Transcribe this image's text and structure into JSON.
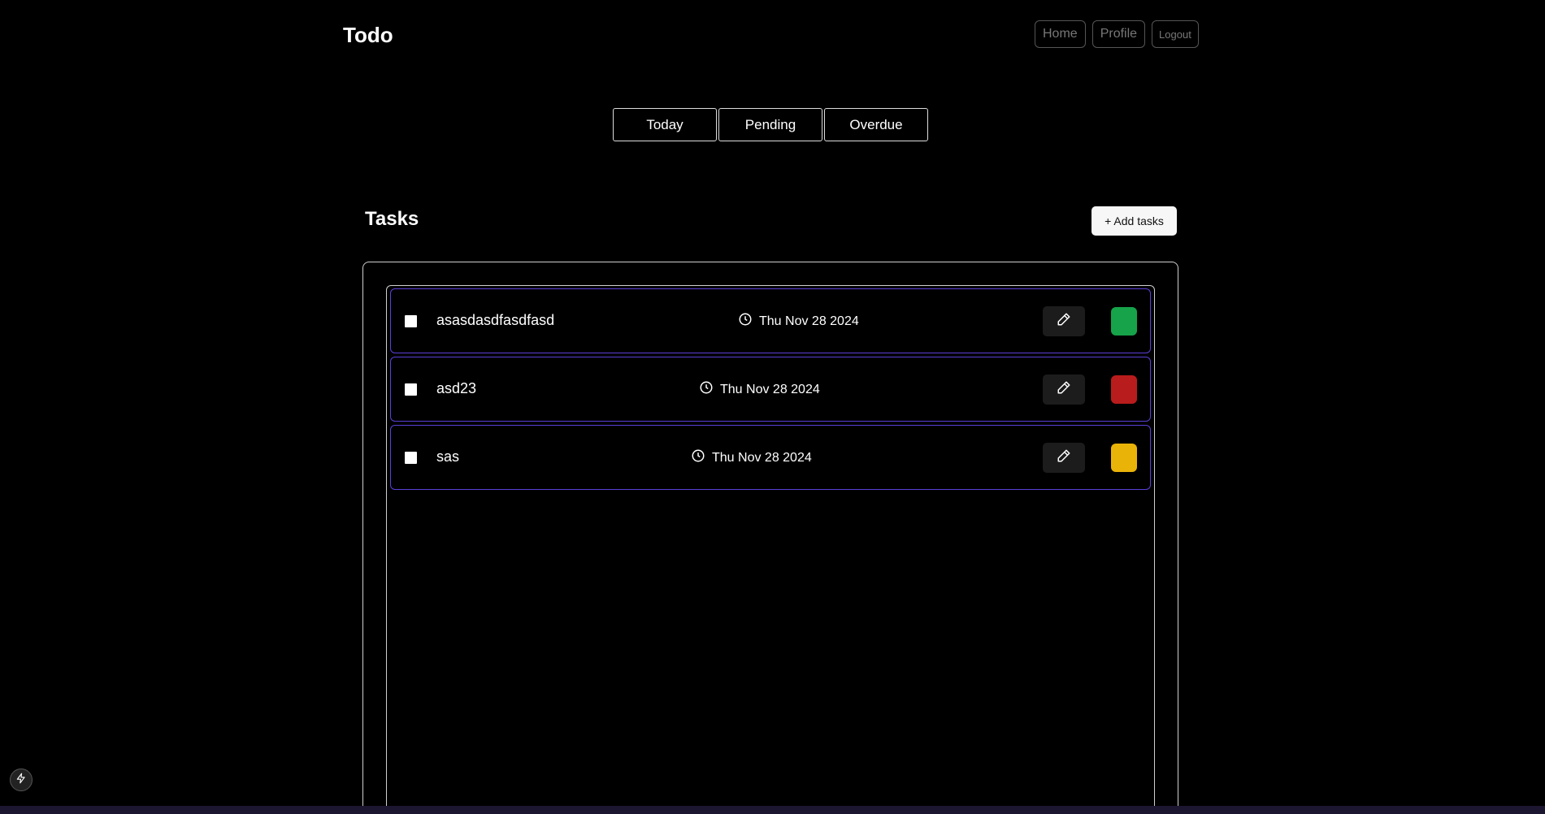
{
  "header": {
    "brand": "Todo",
    "nav": [
      {
        "label": "Home"
      },
      {
        "label": "Profile"
      },
      {
        "label": "Logout"
      }
    ]
  },
  "filters": [
    "Today",
    "Pending",
    "Overdue"
  ],
  "tasks_section": {
    "title": "Tasks",
    "add_label": "+ Add tasks"
  },
  "tasks": [
    {
      "title": "asasdasdfasdfasd",
      "due": "Thu Nov 28 2024",
      "status_color": "#16a34a"
    },
    {
      "title": "asd23",
      "due": "Thu Nov 28 2024",
      "status_color": "#b91c1c"
    },
    {
      "title": "sas",
      "due": "Thu Nov 28 2024",
      "status_color": "#eab308"
    }
  ],
  "colors": {
    "background": "#000000",
    "task_border": "#5b3fd6",
    "panel_border": "#cfcfcf"
  }
}
